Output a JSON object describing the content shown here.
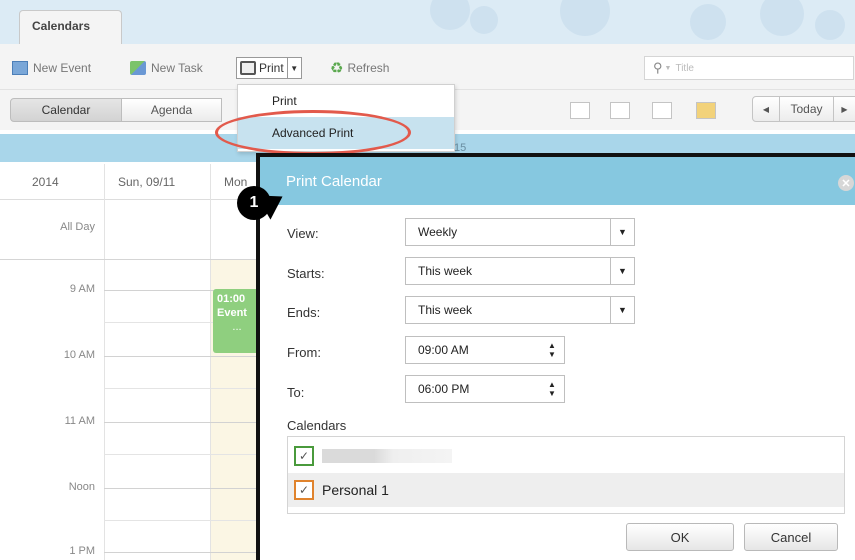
{
  "module_tab": {
    "label": "Calendars"
  },
  "toolbar": {
    "new_event": "New Event",
    "new_task": "New Task",
    "print": "Print",
    "refresh": "Refresh",
    "search_placeholder": "Title"
  },
  "view_tabs": [
    "Calendar",
    "Agenda"
  ],
  "nav": {
    "today": "Today"
  },
  "week_strip": {
    "partial_label": "15"
  },
  "grid": {
    "headers": [
      "2014",
      "Sun, 09/11",
      "Mon"
    ],
    "all_day": "All Day",
    "times": [
      "9 AM",
      "10 AM",
      "11 AM",
      "Noon",
      "1 PM"
    ]
  },
  "event": {
    "time": "01:00",
    "title": "Event",
    "more": "..."
  },
  "print_menu": {
    "items": [
      {
        "label": "Print"
      },
      {
        "label": "Advanced Print"
      }
    ]
  },
  "step_marker": "1",
  "dialog": {
    "title": "Print Calendar",
    "fields": {
      "view": {
        "label": "View:",
        "value": "Weekly"
      },
      "starts": {
        "label": "Starts:",
        "value": "This week"
      },
      "ends": {
        "label": "Ends:",
        "value": "This week"
      },
      "from": {
        "label": "From:",
        "value": "09:00 AM"
      },
      "to": {
        "label": "To:",
        "value": "06:00 PM"
      }
    },
    "calendars_label": "Calendars",
    "calendars": [
      {
        "name": "",
        "checked": true,
        "color": "#4a9a3c"
      },
      {
        "name": "Personal 1",
        "checked": true,
        "color": "#e0832d"
      }
    ],
    "ok": "OK",
    "cancel": "Cancel"
  },
  "colors": {
    "accent_blue": "#86c8e0",
    "highlight_red": "#e25a4c",
    "event_green": "#8fcf7f"
  }
}
